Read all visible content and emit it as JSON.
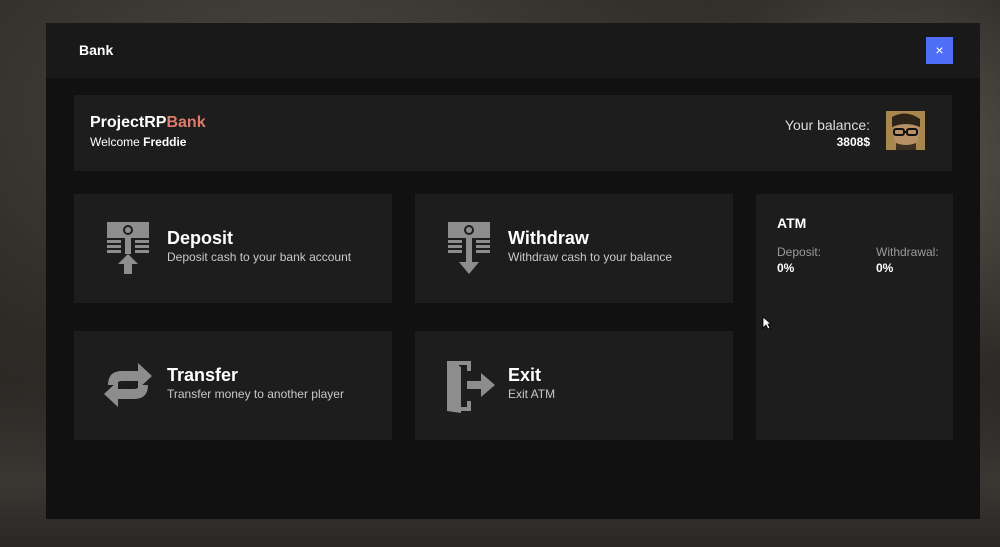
{
  "window": {
    "title": "Bank",
    "close_label": "×"
  },
  "header": {
    "brand_main": "ProjectRP",
    "brand_accent": "Bank",
    "welcome_prefix": "Welcome ",
    "user_name": "Freddie",
    "balance_label": "Your balance:",
    "balance_value": "3808$"
  },
  "tiles": [
    {
      "title": "Deposit",
      "desc": "Deposit cash to your bank account",
      "icon": "deposit-icon"
    },
    {
      "title": "Withdraw",
      "desc": "Withdraw cash to your balance",
      "icon": "withdraw-icon"
    },
    {
      "title": "Transfer",
      "desc": "Transfer money to another player",
      "icon": "transfer-icon"
    },
    {
      "title": "Exit",
      "desc": "Exit ATM",
      "icon": "exit-icon"
    }
  ],
  "atm": {
    "title": "ATM",
    "deposit_label": "Deposit:",
    "deposit_value": "0%",
    "withdrawal_label": "Withdrawal:",
    "withdrawal_value": "0%"
  },
  "colors": {
    "accent": "#4f6ef7",
    "brand_accent": "#e07a6c",
    "panel": "#1d1d1d",
    "window": "#111111"
  }
}
